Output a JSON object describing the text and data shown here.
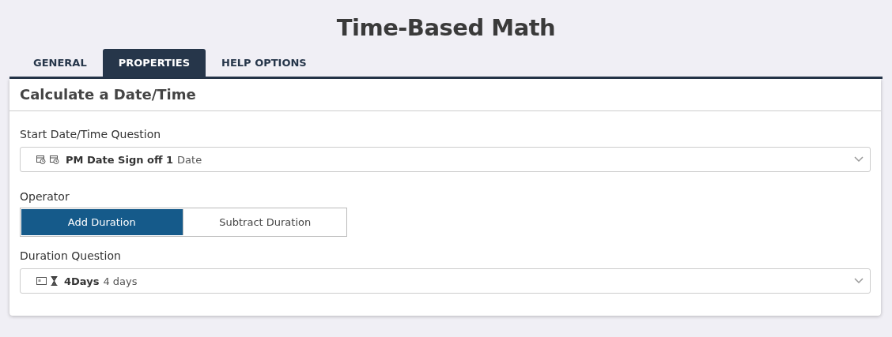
{
  "title": "Time-Based Math",
  "tabs": [
    {
      "label": "GENERAL",
      "selected": false
    },
    {
      "label": "PROPERTIES",
      "selected": true
    },
    {
      "label": "HELP OPTIONS",
      "selected": false
    }
  ],
  "panel": {
    "heading": "Calculate a Date/Time",
    "start_field": {
      "label": "Start Date/Time Question",
      "kind": "date",
      "name": "PM Date Sign off 1",
      "type": "Date"
    },
    "operator": {
      "label": "Operator",
      "options": [
        {
          "label": "Add Duration",
          "selected": true
        },
        {
          "label": "Subtract Duration",
          "selected": false
        }
      ]
    },
    "duration_field": {
      "label": "Duration Question",
      "kind": "duration",
      "name": "4Days",
      "type": "4 days"
    }
  }
}
